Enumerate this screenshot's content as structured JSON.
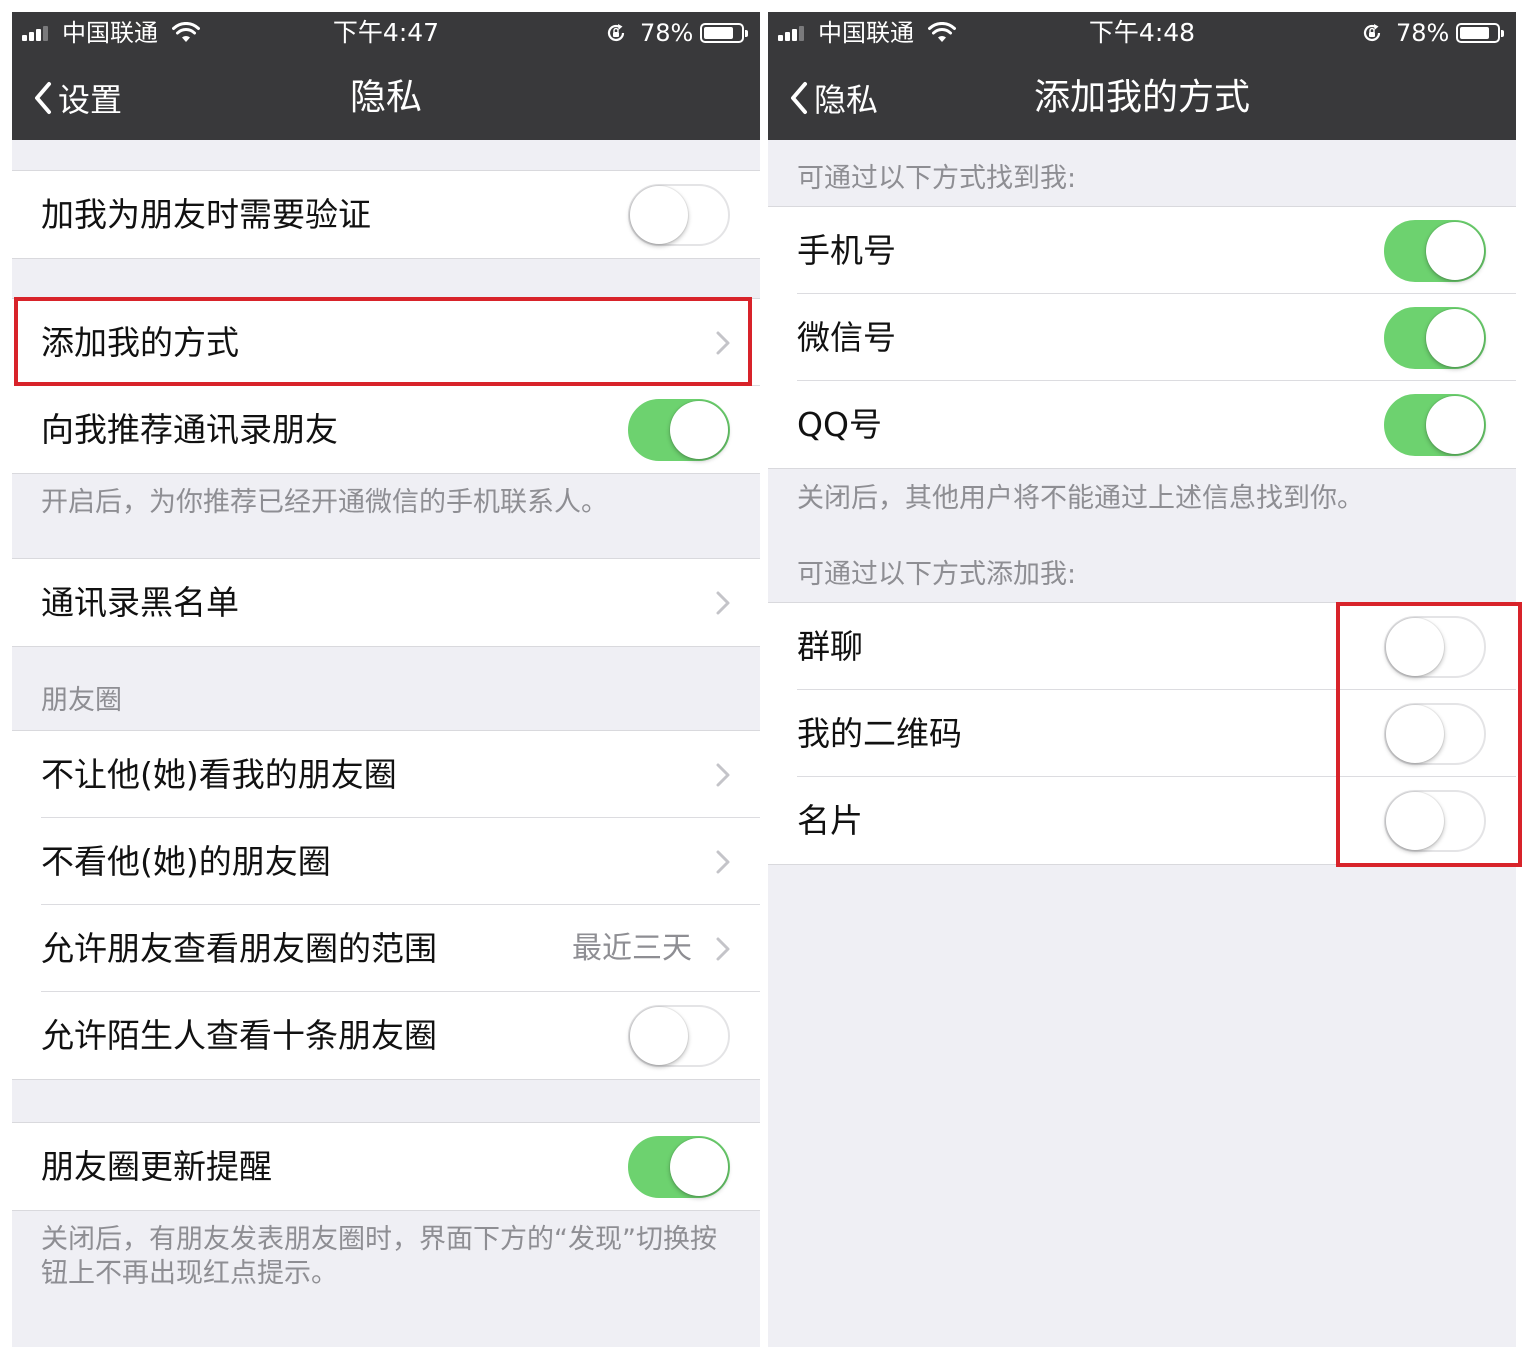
{
  "left": {
    "status": {
      "carrier": "中国联通",
      "time": "下午4:47",
      "battery": "78%"
    },
    "nav": {
      "back": "设置",
      "title": "隐私"
    },
    "rows": {
      "verify": {
        "label": "加我为朋友时需要验证",
        "on": false
      },
      "add_methods": {
        "label": "添加我的方式"
      },
      "recommend_contacts": {
        "label": "向我推荐通讯录朋友",
        "on": true
      },
      "recommend_note": "开启后，为你推荐已经开通微信的手机联系人。",
      "blacklist": {
        "label": "通讯录黑名单"
      },
      "moments_header": "朋友圈",
      "block_view": {
        "label": "不让他(她)看我的朋友圈"
      },
      "hide_view": {
        "label": "不看他(她)的朋友圈"
      },
      "range": {
        "label": "允许朋友查看朋友圈的范围",
        "value": "最近三天"
      },
      "stranger": {
        "label": "允许陌生人查看十条朋友圈",
        "on": false
      },
      "update_reminder": {
        "label": "朋友圈更新提醒",
        "on": true
      },
      "update_note": "关闭后，有朋友发表朋友圈时，界面下方的“发现”切换按钮上不再出现红点提示。"
    }
  },
  "right": {
    "status": {
      "carrier": "中国联通",
      "time": "下午4:48",
      "battery": "78%"
    },
    "nav": {
      "back": "隐私",
      "title": "添加我的方式"
    },
    "find_header": "可通过以下方式找到我:",
    "find_rows": [
      {
        "label": "手机号",
        "on": true
      },
      {
        "label": "微信号",
        "on": true
      },
      {
        "label": "QQ号",
        "on": true
      }
    ],
    "find_note": "关闭后，其他用户将不能通过上述信息找到你。",
    "add_header": "可通过以下方式添加我:",
    "add_rows": [
      {
        "label": "群聊",
        "on": false
      },
      {
        "label": "我的二维码",
        "on": false
      },
      {
        "label": "名片",
        "on": false
      }
    ]
  },
  "colors": {
    "nav_bg": "#39393b",
    "switch_on": "#6dd26f",
    "highlight": "#d8232a",
    "page_bg": "#efeff4"
  }
}
